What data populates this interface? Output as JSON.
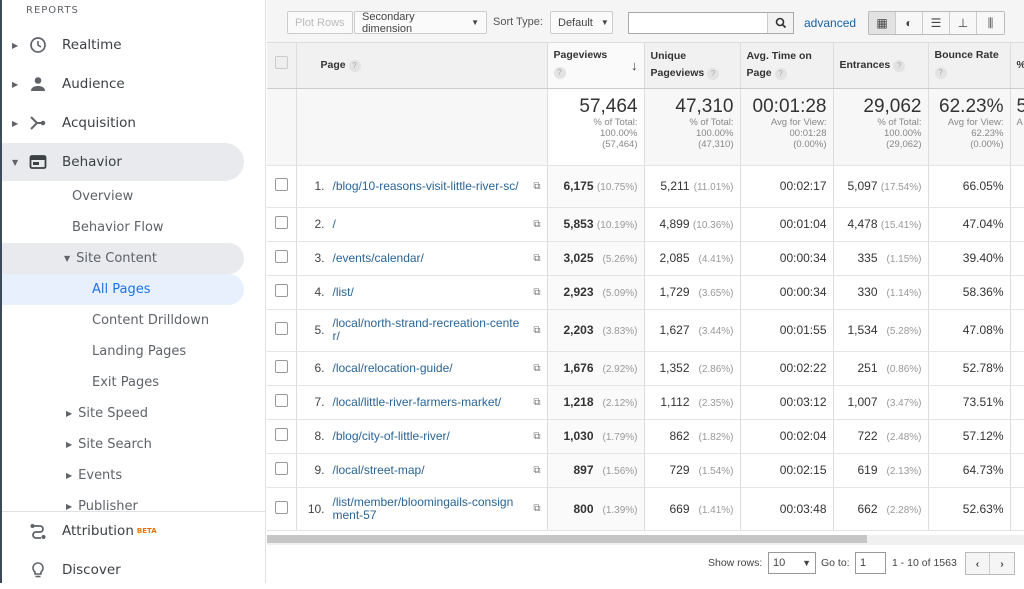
{
  "sidebar": {
    "section": "REPORTS",
    "items": [
      {
        "label": "Realtime",
        "icon": "clock-icon"
      },
      {
        "label": "Audience",
        "icon": "person-icon"
      },
      {
        "label": "Acquisition",
        "icon": "acquisition-icon"
      },
      {
        "label": "Behavior",
        "icon": "behavior-icon"
      }
    ],
    "behavior_sub": {
      "overview": "Overview",
      "flow": "Behavior Flow",
      "site_content": "Site Content",
      "all_pages": "All Pages",
      "drilldown": "Content Drilldown",
      "landing": "Landing Pages",
      "exit": "Exit Pages",
      "speed": "Site Speed",
      "search": "Site Search",
      "events": "Events",
      "publisher": "Publisher"
    },
    "attribution": "Attribution",
    "beta": "BETA",
    "discover": "Discover"
  },
  "toolbar": {
    "plot_rows": "Plot Rows",
    "secondary": "Secondary dimension",
    "sort_type_label": "Sort Type:",
    "sort_type": "Default",
    "search_value": "",
    "advanced": "advanced"
  },
  "table": {
    "headers": {
      "page": "Page",
      "pageviews": "Pageviews",
      "unique1": "Unique",
      "unique2": "Pageviews",
      "avgtime1": "Avg. Time on",
      "avgtime2": "Page",
      "entrances": "Entrances",
      "bounce": "Bounce Rate",
      "next": "%"
    },
    "summary": {
      "pageviews": {
        "big": "57,464",
        "l1": "% of Total:",
        "l2": "100.00%",
        "l3": "(57,464)"
      },
      "unique": {
        "big": "47,310",
        "l1": "% of Total:",
        "l2": "100.00%",
        "l3": "(47,310)"
      },
      "avgtime": {
        "big": "00:01:28",
        "l1": "Avg for View:",
        "l2": "00:01:28",
        "l3": "(0.00%)"
      },
      "entrances": {
        "big": "29,062",
        "l1": "% of Total:",
        "l2": "100.00%",
        "l3": "(29,062)"
      },
      "bounce": {
        "big": "62.23%",
        "l1": "Avg for View:",
        "l2": "62.23%",
        "l3": "(0.00%)"
      },
      "next": {
        "big": "5",
        "l1": "A"
      }
    },
    "rows": [
      {
        "n": "1.",
        "page": "/blog/10-reasons-visit-little-river-sc/",
        "pv": "6,175",
        "pvp": "(10.75%)",
        "up": "5,211",
        "upp": "(11.01%)",
        "t": "00:02:17",
        "e": "5,097",
        "ep": "(17.54%)",
        "b": "66.05%"
      },
      {
        "n": "2.",
        "page": "/",
        "pv": "5,853",
        "pvp": "(10.19%)",
        "up": "4,899",
        "upp": "(10.36%)",
        "t": "00:01:04",
        "e": "4,478",
        "ep": "(15.41%)",
        "b": "47.04%"
      },
      {
        "n": "3.",
        "page": "/events/calendar/",
        "pv": "3,025",
        "pvp": "(5.26%)",
        "up": "2,085",
        "upp": "(4.41%)",
        "t": "00:00:34",
        "e": "335",
        "ep": "(1.15%)",
        "b": "39.40%"
      },
      {
        "n": "4.",
        "page": "/list/",
        "pv": "2,923",
        "pvp": "(5.09%)",
        "up": "1,729",
        "upp": "(3.65%)",
        "t": "00:00:34",
        "e": "330",
        "ep": "(1.14%)",
        "b": "58.36%"
      },
      {
        "n": "5.",
        "page": "/local/north-strand-recreation-center/",
        "pv": "2,203",
        "pvp": "(3.83%)",
        "up": "1,627",
        "upp": "(3.44%)",
        "t": "00:01:55",
        "e": "1,534",
        "ep": "(5.28%)",
        "b": "47.08%"
      },
      {
        "n": "6.",
        "page": "/local/relocation-guide/",
        "pv": "1,676",
        "pvp": "(2.92%)",
        "up": "1,352",
        "upp": "(2.86%)",
        "t": "00:02:22",
        "e": "251",
        "ep": "(0.86%)",
        "b": "52.78%"
      },
      {
        "n": "7.",
        "page": "/local/little-river-farmers-market/",
        "pv": "1,218",
        "pvp": "(2.12%)",
        "up": "1,112",
        "upp": "(2.35%)",
        "t": "00:03:12",
        "e": "1,007",
        "ep": "(3.47%)",
        "b": "73.51%"
      },
      {
        "n": "8.",
        "page": "/blog/city-of-little-river/",
        "pv": "1,030",
        "pvp": "(1.79%)",
        "up": "862",
        "upp": "(1.82%)",
        "t": "00:02:04",
        "e": "722",
        "ep": "(2.48%)",
        "b": "57.12%"
      },
      {
        "n": "9.",
        "page": "/local/street-map/",
        "pv": "897",
        "pvp": "(1.56%)",
        "up": "729",
        "upp": "(1.54%)",
        "t": "00:02:15",
        "e": "619",
        "ep": "(2.13%)",
        "b": "64.73%"
      },
      {
        "n": "10.",
        "page": "/list/member/bloomingails-consignment-57",
        "pv": "800",
        "pvp": "(1.39%)",
        "up": "669",
        "upp": "(1.41%)",
        "t": "00:03:48",
        "e": "662",
        "ep": "(2.28%)",
        "b": "52.63%"
      }
    ]
  },
  "footer": {
    "show_rows_label": "Show rows:",
    "show_rows": "10",
    "goto_label": "Go to:",
    "goto": "1",
    "range": "1 - 10 of 1563"
  }
}
